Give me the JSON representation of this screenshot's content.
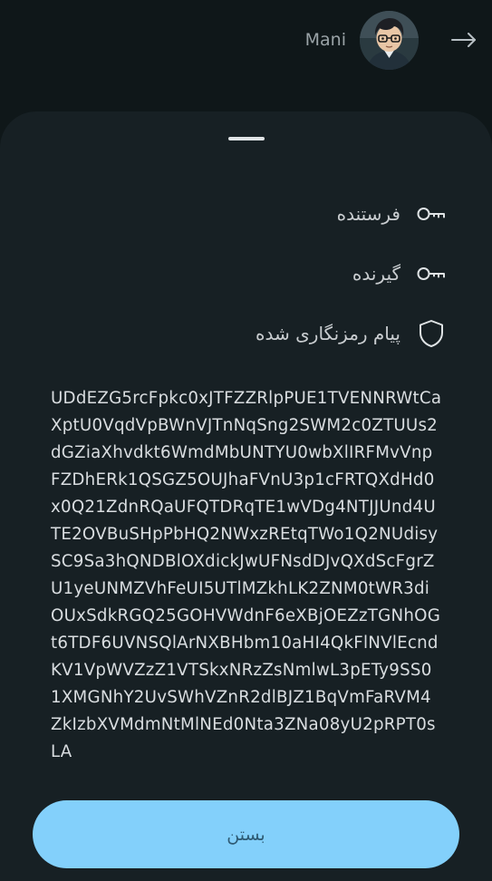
{
  "header": {
    "username": "Mani",
    "back_icon": "arrow-right-icon",
    "avatar_icon": "user-avatar"
  },
  "sheet": {
    "rows": [
      {
        "label": "فرستنده",
        "icon": "key-icon"
      },
      {
        "label": "گیرنده",
        "icon": "key-icon"
      },
      {
        "label": "پیام رمزنگاری شده",
        "icon": "shield-icon"
      }
    ],
    "cipher_text": "UDdEZG5rcFpkc0xJTFZZRlpPUE1TVENNRWtCaXptU0VqdVpBWnVJTnNqSng2SWM2c0ZTUUs2dGZiaXhvdkt6WmdMbUNTYU0wbXlIRFMvVnpFZDhERk1QSGZ5OUJhaFVnU3p1cFRTQXdHd0x0Q21ZdnRQaUFQTDRqTE1wVDg4NTJJUnd4UTE2OVBuSHpPbHQ2NWxzREtqTWo1Q2NUdisySC9Sa3hQNDBlOXdickJwUFNsdDJvQXdScFgrZU1yeUNMZVhFeUI5UTlMZkhLK2ZNM0tWR3diOUxSdkRGQ25GOHVWdnF6eXBjOEZzTGNhOGt6TDF6UVNSQlArNXBHbm10aHI4QkFlNVlEcndKV1VpWVZzZ1VTSkxNRzZsNmlwL3pETy9SS01XMGNhY2UvSWhVZnR2dlBJZ1BqVmFaRVM4ZkIzbXVMdmNtMlNEd0Nta3ZNa08yU2pRPT0sLA",
    "close_label": "بستن"
  },
  "colors": {
    "background": "#0f1719",
    "sheet": "#172024",
    "accent": "#83d0fb",
    "button_text": "#2e5a73"
  }
}
